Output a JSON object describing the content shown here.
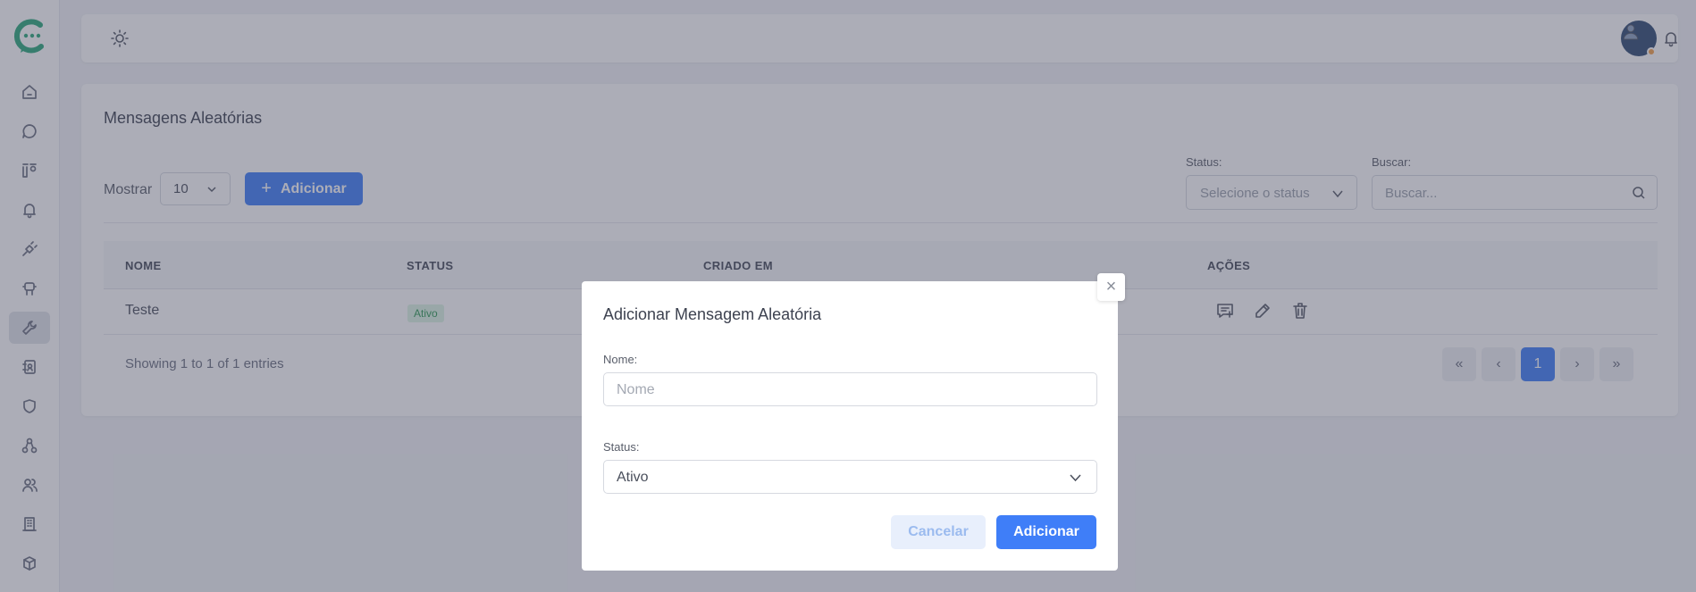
{
  "sidebar": {
    "logo": "chat-logo",
    "items": [
      {
        "icon": "home-icon"
      },
      {
        "icon": "chat-bubble-icon"
      },
      {
        "icon": "kanban-icon"
      },
      {
        "icon": "bell-icon"
      },
      {
        "icon": "plug-icon"
      },
      {
        "icon": "robot-icon"
      },
      {
        "icon": "wrench-icon",
        "active": true
      },
      {
        "icon": "contact-book-icon"
      },
      {
        "icon": "shield-icon"
      },
      {
        "icon": "sitemap-icon"
      },
      {
        "icon": "users-icon"
      },
      {
        "icon": "building-icon"
      },
      {
        "icon": "box-icon"
      }
    ]
  },
  "topbar": {
    "theme_icon": "sun-icon",
    "translate_icon": "translate-icon",
    "notification_icon": "bell-icon",
    "avatar_status_color": "#f5a04a"
  },
  "page": {
    "title": "Mensagens Aleatórias",
    "show_label": "Mostrar",
    "page_size": "10",
    "add_label": "Adicionar",
    "status_filter_label": "Status:",
    "status_filter_placeholder": "Selecione o status",
    "search_label": "Buscar:",
    "search_placeholder": "Buscar...",
    "table": {
      "headers": [
        "NOME",
        "STATUS",
        "CRIADO EM",
        "AÇÕES"
      ],
      "rows": [
        {
          "name": "Teste",
          "status": "Ativo"
        }
      ]
    },
    "info": "Showing 1 to 1 of 1 entries",
    "pagination": {
      "first": "«",
      "prev": "‹",
      "current": "1",
      "next": "›",
      "last": "»"
    }
  },
  "modal": {
    "title": "Adicionar Mensagem Aleatória",
    "close_label": "×",
    "name_label": "Nome:",
    "name_placeholder": "Nome",
    "status_label": "Status:",
    "status_value": "Ativo",
    "cancel_label": "Cancelar",
    "submit_label": "Adicionar"
  },
  "colors": {
    "primary": "#3f7ef8",
    "success_badge_bg": "#dcf5e3",
    "success_badge_text": "#2f9a55"
  }
}
